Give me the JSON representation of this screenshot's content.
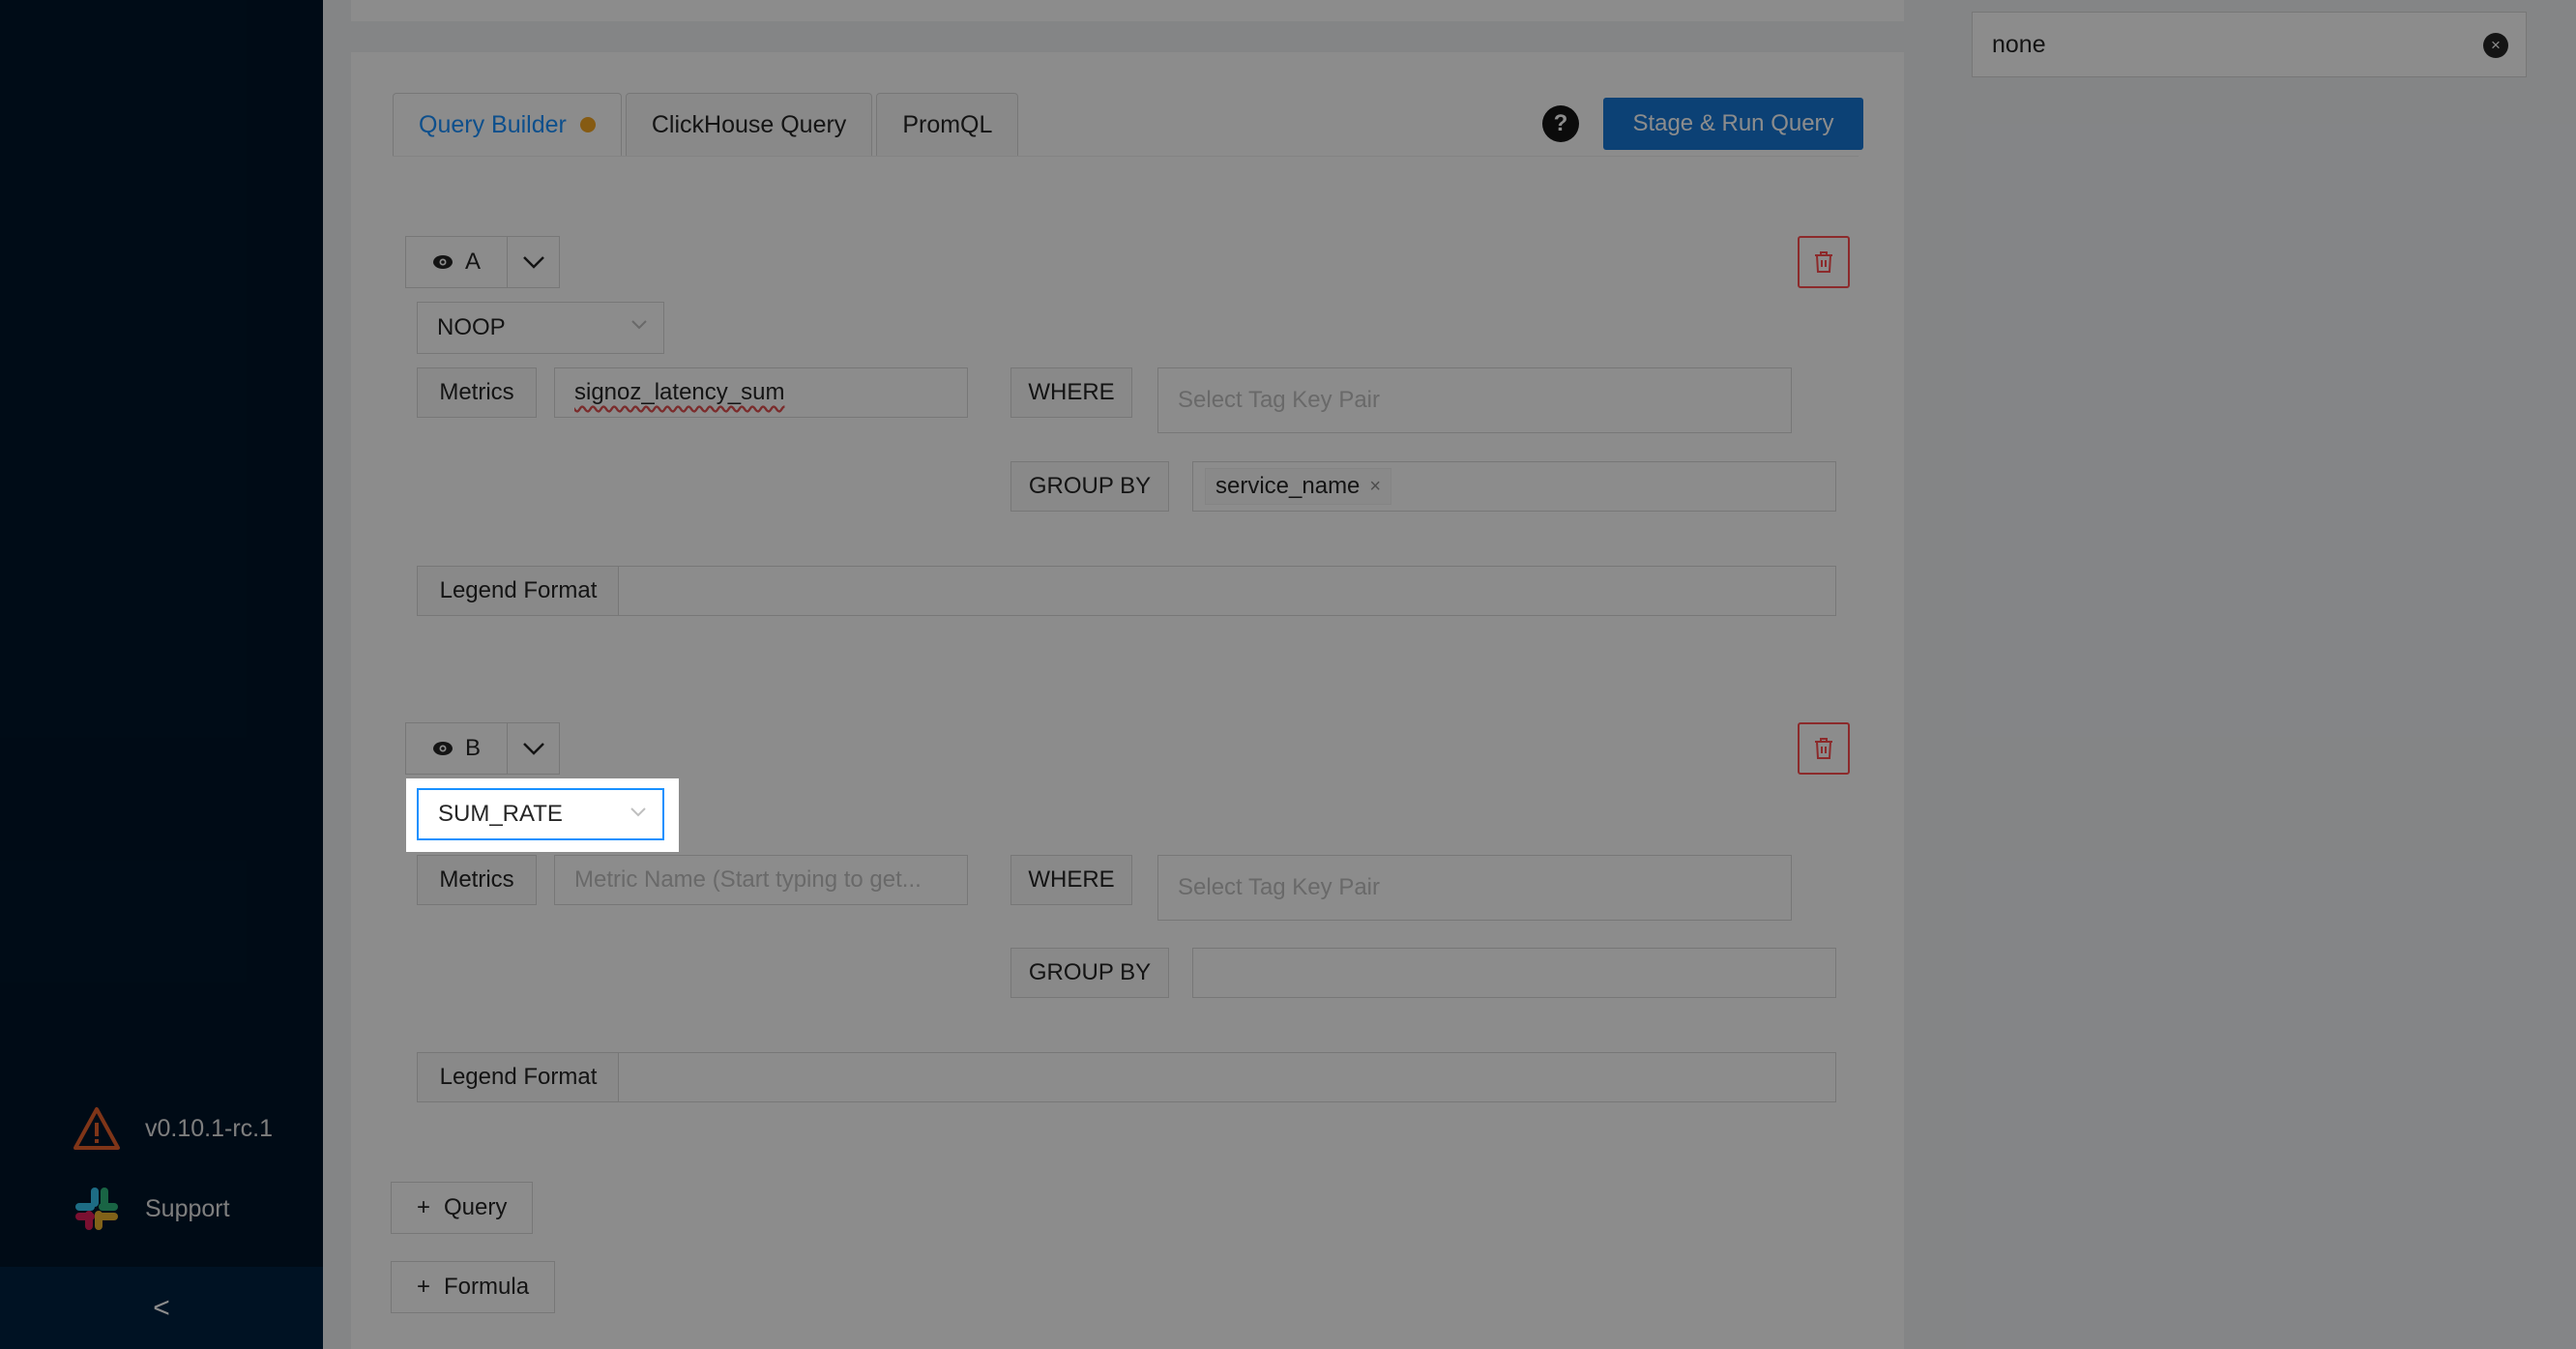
{
  "sidebar": {
    "version": "v0.10.1-rc.1",
    "support": "Support",
    "collapse_glyph": "<"
  },
  "tabs": [
    {
      "label": "Query Builder"
    },
    {
      "label": "ClickHouse Query"
    },
    {
      "label": "PromQL"
    }
  ],
  "toolbar": {
    "help_glyph": "?",
    "run_label": "Stage & Run Query"
  },
  "queries": [
    {
      "name": "A",
      "aggregation": "NOOP",
      "metrics_label": "Metrics",
      "metric_value": "signoz_latency_sum",
      "where_label": "WHERE",
      "where_placeholder": "Select Tag Key Pair",
      "groupby_label": "GROUP BY",
      "groupby_tag": "service_name",
      "legend_label": "Legend Format"
    },
    {
      "name": "B",
      "aggregation": "SUM_RATE",
      "metrics_label": "Metrics",
      "metric_placeholder": "Metric Name (Start typing to get...",
      "where_label": "WHERE",
      "where_placeholder": "Select Tag Key Pair",
      "groupby_label": "GROUP BY",
      "legend_label": "Legend Format"
    }
  ],
  "actions": {
    "add_query": "Query",
    "add_formula": "Formula",
    "plus_glyph": "+"
  },
  "right_panel": {
    "value": "none",
    "clear_glyph": "×"
  },
  "colors": {
    "sidebar_bg": "#001529",
    "accent": "#1890ff",
    "run_button": "#1677d6",
    "danger": "#ff4d4f",
    "status_dot": "#f5a623"
  }
}
